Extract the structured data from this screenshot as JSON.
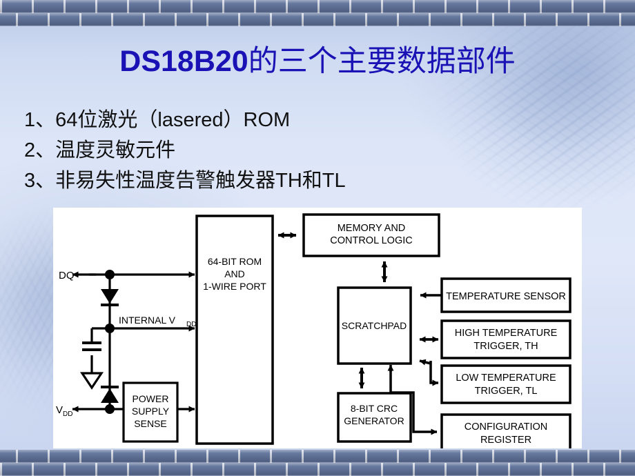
{
  "slide": {
    "title_en": "DS18B20",
    "title_cn": "的三个主要数据部件",
    "title_color": "#1a12b4",
    "bullets": [
      "1、64位激光（lasered）ROM",
      "2、温度灵敏元件",
      "3、非易失性温度告警触发器TH和TL"
    ]
  },
  "diagram": {
    "name": "ds18b20-block-diagram",
    "pins": {
      "dq": "DQ",
      "vdd": "V",
      "vdd_sub": "DD",
      "internal_vdd": "INTERNAL V",
      "internal_vdd_sub": "DD"
    },
    "blocks": {
      "rom": {
        "line1": "64-BIT ROM",
        "line2": "AND",
        "line3": "1-WIRE PORT"
      },
      "power_supply_sense": {
        "line1": "POWER",
        "line2": "SUPPLY",
        "line3": "SENSE"
      },
      "memory_control": {
        "line1": "MEMORY AND",
        "line2": "CONTROL LOGIC"
      },
      "scratchpad": {
        "line1": "SCRATCHPAD"
      },
      "crc": {
        "line1": "8-BIT CRC",
        "line2": "GENERATOR"
      },
      "temperature_sensor": {
        "line1": "TEMPERATURE SENSOR"
      },
      "high_temp_trigger": {
        "line1": "HIGH TEMPERATURE",
        "line2": "TRIGGER, TH"
      },
      "low_temp_trigger": {
        "line1": "LOW TEMPERATURE",
        "line2": "TRIGGER, TL"
      },
      "config_register": {
        "line1": "CONFIGURATION",
        "line2": "REGISTER"
      }
    }
  }
}
